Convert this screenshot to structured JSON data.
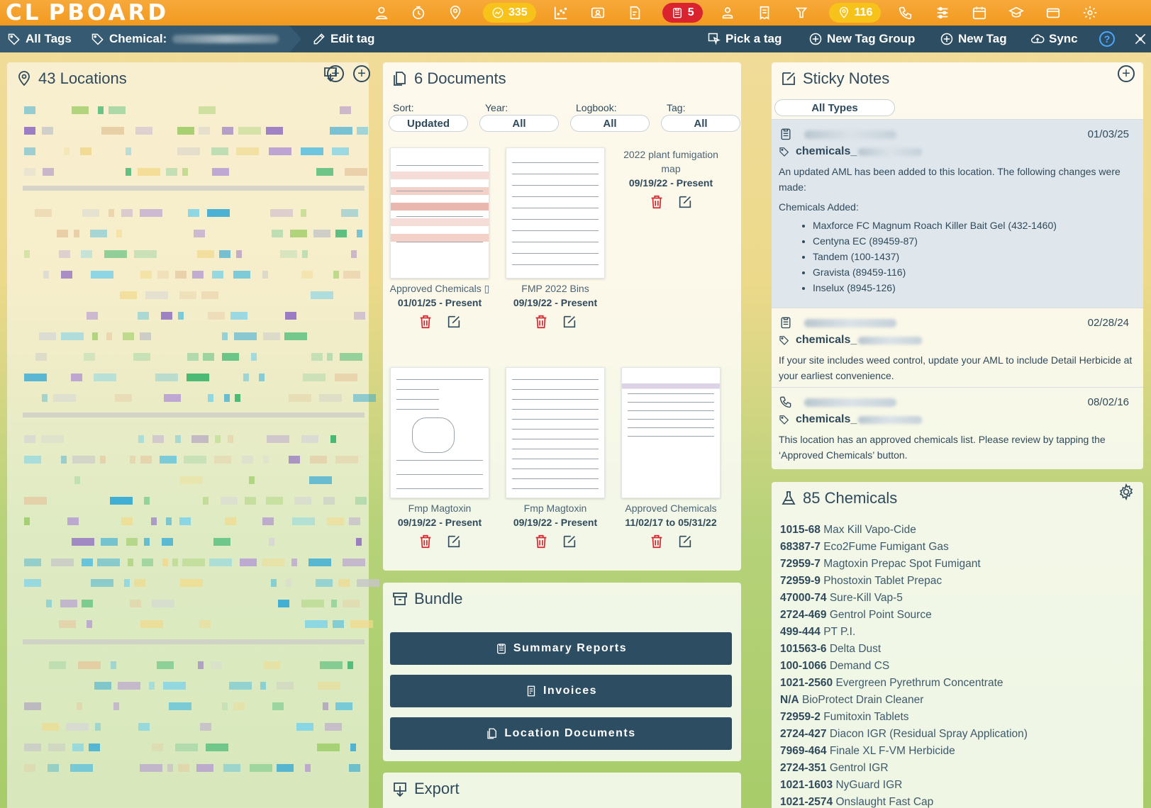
{
  "app": {
    "logo": "CL PBOARD"
  },
  "topbar": {
    "badge_alerts": "335",
    "badge_documents": "5",
    "badge_locations": "116"
  },
  "subbar": {
    "all_tags": "All Tags",
    "chemical_label": "Chemical:",
    "edit_tag": "Edit tag",
    "pick_a_tag": "Pick a tag",
    "new_tag_group": "New Tag Group",
    "new_tag": "New Tag",
    "sync": "Sync",
    "help": "?"
  },
  "locations": {
    "title": "43 Locations"
  },
  "documents": {
    "title": "6 Documents",
    "filters": [
      {
        "label": "Sort:",
        "value": "Updated"
      },
      {
        "label": "Year:",
        "value": "All"
      },
      {
        "label": "Logbook:",
        "value": "All"
      },
      {
        "label": "Tag:",
        "value": "All"
      }
    ],
    "items": [
      {
        "name": "Approved Chemicals ▯",
        "date": "01/01/25 - Present"
      },
      {
        "name": "FMP 2022 Bins",
        "date": "09/19/22 - Present"
      },
      {
        "name": "2022 plant fumigation map",
        "date": "09/19/22 - Present"
      },
      {
        "name": "Fmp Magtoxin",
        "date": "09/19/22 - Present"
      },
      {
        "name": "Fmp Magtoxin",
        "date": "09/19/22 - Present"
      },
      {
        "name": "Approved Chemicals",
        "date": "11/02/17 to 05/31/22"
      }
    ]
  },
  "bundle": {
    "title": "Bundle",
    "summary_reports": "Summary Reports",
    "invoices": "Invoices",
    "location_documents": "Location Documents"
  },
  "export": {
    "title": "Export"
  },
  "notes": {
    "title": "Sticky Notes",
    "filter": "All Types",
    "items": [
      {
        "date": "01/03/25",
        "tag": "chemicals_",
        "text": "An updated AML has been added to this location. The following changes were made:",
        "subhead": "Chemicals Added:",
        "list": [
          "Maxforce FC Magnum Roach Killer Bait Gel (432-1460)",
          "Centyna EC (89459-87)",
          "Tandem (100-1437)",
          "Gravista (89459-116)",
          "Inselux (8945-126)"
        ]
      },
      {
        "date": "02/28/24",
        "tag": "chemicals_",
        "text": "If your site includes weed control, update your AML to include Detail Herbicide at your earliest convenience."
      },
      {
        "date": "08/02/16",
        "tag": "chemicals_",
        "text": "This location has an approved chemicals list. Please review by tapping the ‘Approved Chemicals’ button."
      }
    ]
  },
  "chemicals": {
    "title": "85 Chemicals",
    "items": [
      {
        "code": "1015-68",
        "name": "Max Kill Vapo-Cide"
      },
      {
        "code": "68387-7",
        "name": "Eco2Fume Fumigant Gas"
      },
      {
        "code": "72959-7",
        "name": "Magtoxin Prepac Spot Fumigant"
      },
      {
        "code": "72959-9",
        "name": "Phostoxin Tablet Prepac"
      },
      {
        "code": "47000-74",
        "name": "Sure-Kill Vap-5"
      },
      {
        "code": "2724-469",
        "name": "Gentrol Point Source"
      },
      {
        "code": "499-444",
        "name": "PT P.I."
      },
      {
        "code": "101563-6",
        "name": "Delta Dust"
      },
      {
        "code": "100-1066",
        "name": "Demand CS"
      },
      {
        "code": "1021-2560",
        "name": "Evergreen Pyrethrum Concentrate"
      },
      {
        "code": "N/A",
        "name": "BioProtect Drain Cleaner"
      },
      {
        "code": "72959-2",
        "name": "Fumitoxin Tablets"
      },
      {
        "code": "2724-427",
        "name": "Diacon IGR (Residual Spray Application)"
      },
      {
        "code": "7969-464",
        "name": "Finale XL F-VM Herbicide"
      },
      {
        "code": "2724-351",
        "name": "Gentrol IGR"
      },
      {
        "code": "1021-1603",
        "name": "NyGuard IGR"
      },
      {
        "code": "1021-2574",
        "name": "Onslaught Fast Cap"
      }
    ]
  }
}
